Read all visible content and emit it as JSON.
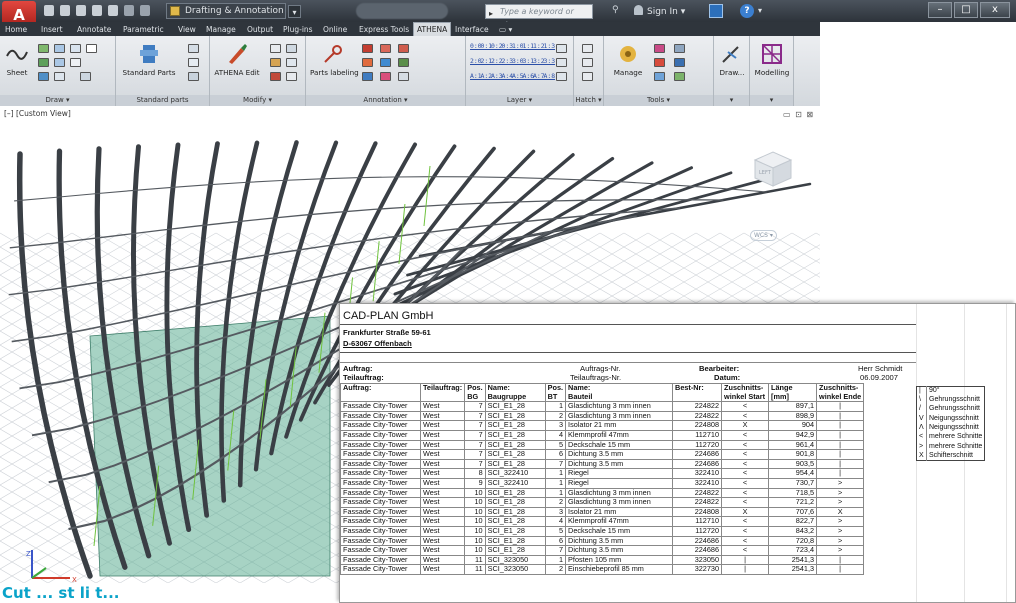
{
  "app": {
    "logo_letter": "A",
    "workspace": "Drafting & Annotation",
    "doc_title": "",
    "search_placeholder": "Type a keyword or phrase",
    "sign_in": "Sign In",
    "help": "?",
    "win_min": "–",
    "win_max": "□",
    "win_close": "x"
  },
  "ribbon": {
    "tabs": [
      "Home",
      "Insert",
      "Annotate",
      "Parametric",
      "View",
      "Manage",
      "Output",
      "Plug-ins",
      "Online",
      "Express Tools",
      "ATHENA",
      "Interface",
      "▭ ▾"
    ],
    "active_tab": "ATHENA",
    "buttons": {
      "sheet": "Sheet",
      "standard_parts": "Standard Parts",
      "athena_edit": "ATHENA Edit",
      "parts_labeling": "Parts labeling",
      "manage": "Manage",
      "draw": "Draw...",
      "modelling": "Modelling"
    },
    "scale_rows": [
      [
        "0:0",
        "0:1",
        "0:2",
        "0:3",
        "1:0",
        "1:1",
        "1:2",
        "1:3"
      ],
      [
        "2:0",
        "2:1",
        "2:2",
        "2:3",
        "3:0",
        "3:1",
        "3:2",
        "3:3"
      ],
      [
        "A:1",
        "A:2",
        "A:3",
        "A:4",
        "A:5",
        "A:6",
        "A:7",
        "A:8"
      ]
    ],
    "panels": [
      "Draw ▾",
      "Standard parts",
      "Modify ▾",
      "Annotation ▾",
      "Layer ▾",
      "Hatch ▾",
      "Tools ▾",
      "▾",
      "▾"
    ]
  },
  "viewport": {
    "label": "[–] [Custom View]",
    "controls": "▭ ⊡ ⊠",
    "wcs_label": "WCS ▾",
    "viewcube_face": "LEFT"
  },
  "sheet": {
    "company": "CAD-PLAN GmbH",
    "street": "Frankfurter Straße 59-61",
    "city": "D-63067 Offenbach",
    "auftrag_label": "Auftrag:",
    "auftrag_value": "Auftrags-Nr.",
    "teilauftrag_label": "Teilauftrag:",
    "teilauftrag_value": "Teilauftrags-Nr.",
    "bearbeiter_label": "Bearbeiter:",
    "bearbeiter_value": "Herr Schmidt",
    "datum_label": "Datum:",
    "datum_value": "06.09.2007",
    "headers": [
      "Auftrag:",
      "Teilauftrag:",
      "Pos.\nBG",
      "Name:\nBaugruppe",
      "Pos.\nBT",
      "Name:\nBauteil",
      "Best-Nr:",
      "Zuschnitts-\nwinkel Start",
      "Länge\n[mm]",
      "Zuschnitts-\nwinkel Ende"
    ],
    "rows": [
      [
        "Fassade City-Tower",
        "West",
        "7",
        "SCI_E1_28",
        "1",
        "Glasdichtung 3 mm innen",
        "224822",
        "<",
        "897,1",
        "|"
      ],
      [
        "Fassade City-Tower",
        "West",
        "7",
        "SCI_E1_28",
        "2",
        "Glasdichtung 3 mm innen",
        "224822",
        "<",
        "898,9",
        "|"
      ],
      [
        "Fassade City-Tower",
        "West",
        "7",
        "SCI_E1_28",
        "3",
        "Isolator 21 mm",
        "224808",
        "X",
        "904",
        "|"
      ],
      [
        "Fassade City-Tower",
        "West",
        "7",
        "SCI_E1_28",
        "4",
        "Klemmprofil 47mm",
        "112710",
        "<",
        "942,9",
        "|"
      ],
      [
        "Fassade City-Tower",
        "West",
        "7",
        "SCI_E1_28",
        "5",
        "Deckschale 15 mm",
        "112720",
        "<",
        "961,4",
        "|"
      ],
      [
        "Fassade City-Tower",
        "West",
        "7",
        "SCI_E1_28",
        "6",
        "Dichtung 3.5 mm",
        "224686",
        "<",
        "901,8",
        "|"
      ],
      [
        "Fassade City-Tower",
        "West",
        "7",
        "SCI_E1_28",
        "7",
        "Dichtung 3.5 mm",
        "224686",
        "<",
        "903,5",
        "|"
      ],
      [
        "Fassade City-Tower",
        "West",
        "8",
        "SCI_322410",
        "1",
        "Riegel",
        "322410",
        "<",
        "954,4",
        "|"
      ],
      [
        "Fassade City-Tower",
        "West",
        "9",
        "SCI_322410",
        "1",
        "Riegel",
        "322410",
        "<",
        "730,7",
        ">"
      ],
      [
        "Fassade City-Tower",
        "West",
        "10",
        "SCI_E1_28",
        "1",
        "Glasdichtung 3 mm innen",
        "224822",
        "<",
        "718,5",
        ">"
      ],
      [
        "Fassade City-Tower",
        "West",
        "10",
        "SCI_E1_28",
        "2",
        "Glasdichtung 3 mm innen",
        "224822",
        "<",
        "721,2",
        ">"
      ],
      [
        "Fassade City-Tower",
        "West",
        "10",
        "SCI_E1_28",
        "3",
        "Isolator 21 mm",
        "224808",
        "X",
        "707,6",
        "X"
      ],
      [
        "Fassade City-Tower",
        "West",
        "10",
        "SCI_E1_28",
        "4",
        "Klemmprofil 47mm",
        "112710",
        "<",
        "822,7",
        ">"
      ],
      [
        "Fassade City-Tower",
        "West",
        "10",
        "SCI_E1_28",
        "5",
        "Deckschale 15 mm",
        "112720",
        "<",
        "843,2",
        ">"
      ],
      [
        "Fassade City-Tower",
        "West",
        "10",
        "SCI_E1_28",
        "6",
        "Dichtung 3.5 mm",
        "224686",
        "<",
        "720,8",
        ">"
      ],
      [
        "Fassade City-Tower",
        "West",
        "10",
        "SCI_E1_28",
        "7",
        "Dichtung 3.5 mm",
        "224686",
        "<",
        "723,4",
        ">"
      ],
      [
        "Fassade City-Tower",
        "West",
        "11",
        "SCI_323050",
        "1",
        "Pfosten 105 mm",
        "323050",
        "|",
        "2541,3",
        "|"
      ],
      [
        "Fassade City-Tower",
        "West",
        "11",
        "SCI_323050",
        "2",
        "Einschiebeprofil 85 mm",
        "322730",
        "|",
        "2541,3",
        "|"
      ]
    ],
    "legend": [
      [
        "|",
        "90°"
      ],
      [
        "\\",
        "Gehrungsschnitt"
      ],
      [
        "/",
        "Gehrungsschnitt"
      ],
      [
        "V",
        "Neigungsschnitt"
      ],
      [
        "Λ",
        "Neigungsschnitt"
      ],
      [
        "<",
        "mehrere Schnitte"
      ],
      [
        ">",
        "mehrere Schnitte"
      ],
      [
        "X",
        "Schifterschnitt"
      ]
    ]
  },
  "caption": "Cut ... st li t..."
}
